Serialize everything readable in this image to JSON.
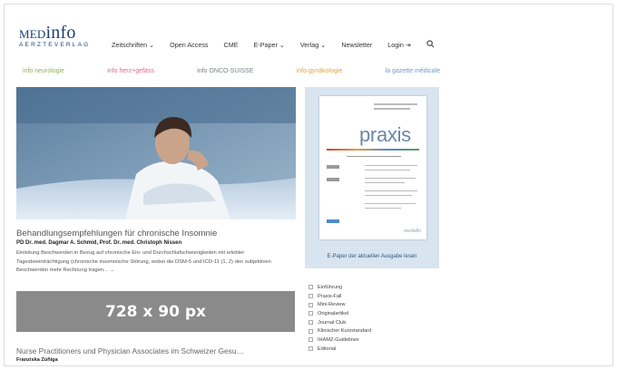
{
  "header": {
    "logo_brand_prefix": "MED",
    "logo_brand_suffix": "info",
    "logo_sub": "AERZTEVERLAG",
    "nav": [
      {
        "label": "Zeitschriften ⌄"
      },
      {
        "label": "Open Access"
      },
      {
        "label": "CME"
      },
      {
        "label": "E-Paper ⌄"
      },
      {
        "label": "Verlag ⌄"
      },
      {
        "label": "Newsletter"
      },
      {
        "label": "Login ⇥"
      }
    ],
    "search_icon": "search-icon"
  },
  "partners": [
    {
      "label": "info neurologie"
    },
    {
      "label": "info herz+gefäss"
    },
    {
      "label": "info ONCO-SUISSE"
    },
    {
      "label": "info gynäkologie"
    },
    {
      "label": "la gazette médicale"
    }
  ],
  "colors": {
    "brand": "#1a3e73",
    "partner_1": "#8fae5b",
    "partner_2": "#e06a8a",
    "partner_3": "#7a7f86",
    "partner_4": "#e2a53a",
    "partner_5": "#6e9bc9",
    "epaper_bg": "#d8e4ef",
    "ad_bg": "#8a8a8a"
  },
  "article": {
    "title": "Behandlungsempfehlungen für chronische Insomnie",
    "authors": "PD Dr. med. Dagmar A. Schmid, Prof. Dr. med. Christoph Nissen",
    "text": "Einleitung Beschwerden in Bezug auf chronische Ein- und Durchschlafschwierigkeiten mit erlebter Tagesbeeinträchtigung (chronische insomnische Störung, wobei die DSM-5 und ICD-11 (1, 2) den subjektiven Beschwerden mehr Rechnung tragen... →"
  },
  "ad": {
    "label": "728 x 90 px"
  },
  "article2": {
    "title": "Nurse Practitioners und Physician Associates im Schweizer Gesu…",
    "author": "Franziska Zúñiga"
  },
  "epaper": {
    "cover_title": "praxis",
    "cover_brand": "mediaflo",
    "caption": "E-Paper der aktuellen Ausgabe lesen"
  },
  "categories": [
    "Einführung",
    "Praxis-Fall",
    "Mini-Review",
    "Originalartikel",
    "Journal Club",
    "Klinischer Kurzstandard",
    "IHAMZ-Guidelines",
    "Editorial"
  ]
}
